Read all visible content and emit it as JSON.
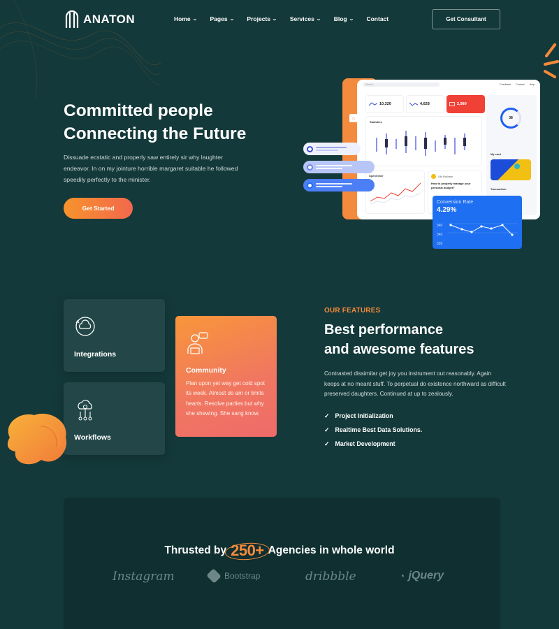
{
  "header": {
    "logo_text": "ANATON",
    "nav": [
      {
        "label": "Home",
        "has_dropdown": true
      },
      {
        "label": "Pages",
        "has_dropdown": true
      },
      {
        "label": "Projects",
        "has_dropdown": true
      },
      {
        "label": "Services",
        "has_dropdown": true
      },
      {
        "label": "Blog",
        "has_dropdown": true
      },
      {
        "label": "Contact",
        "has_dropdown": false
      }
    ],
    "cta_label": "Get Consultant"
  },
  "hero": {
    "title_line1": "Committed people",
    "title_line2": "Connecting the Future",
    "description": "Dissuade ecstatic and properly saw entirely sir why laughter endeavor. In on my jointure horrible margaret suitable he followed speedily perfectly to the minister.",
    "button_label": "Get Started"
  },
  "dashboard": {
    "search_placeholder": "Search",
    "links": [
      "Feedback",
      "Contact",
      "Help"
    ],
    "stats": [
      "10,320",
      "4,628",
      "2,980"
    ],
    "statistics_title": "Statistics",
    "spent_title": "Spent time",
    "budget_question": "How to properly manage your personal budget?",
    "budget_user": "Lilla Robinson",
    "gauge_value": "38",
    "mycard_title": "My card",
    "transaction_title": "Transaction",
    "conversion_title": "Conversion Rate",
    "conversion_value": "4.29%",
    "conversion_axis": [
      "340",
      "340",
      "320"
    ]
  },
  "features": {
    "cards": {
      "integrations": "Integrations",
      "workflows": "Workflows",
      "community_title": "Community",
      "community_desc": "Plan upon yet way get cold spot its week. Almost do am or limits hearts. Resolve parties but why she shewing. She sang know."
    },
    "kicker": "OUR FEATURES",
    "title_line1": "Best performance",
    "title_line2": "and awesome features",
    "description": "Contrasted dissimilar get joy you instrument out reasonably. Again keeps at no meant stuff. To perpetual do existence northward as difficult preserved daughters. Continued at up to zealously.",
    "list": [
      "Project Initialization",
      "Realtime Best Data Solutions.",
      "Market Development"
    ]
  },
  "trusted": {
    "prefix": "Thrusted by",
    "number": "250+",
    "suffix": "Agencies in whole world",
    "brands": [
      "Instagram",
      "Bootstrap",
      "dribbble",
      "jQuery"
    ]
  },
  "colors": {
    "background": "#14393a",
    "accent_orange": "#f68a3b",
    "card_dark": "#234748",
    "blue": "#1e6ff2"
  }
}
